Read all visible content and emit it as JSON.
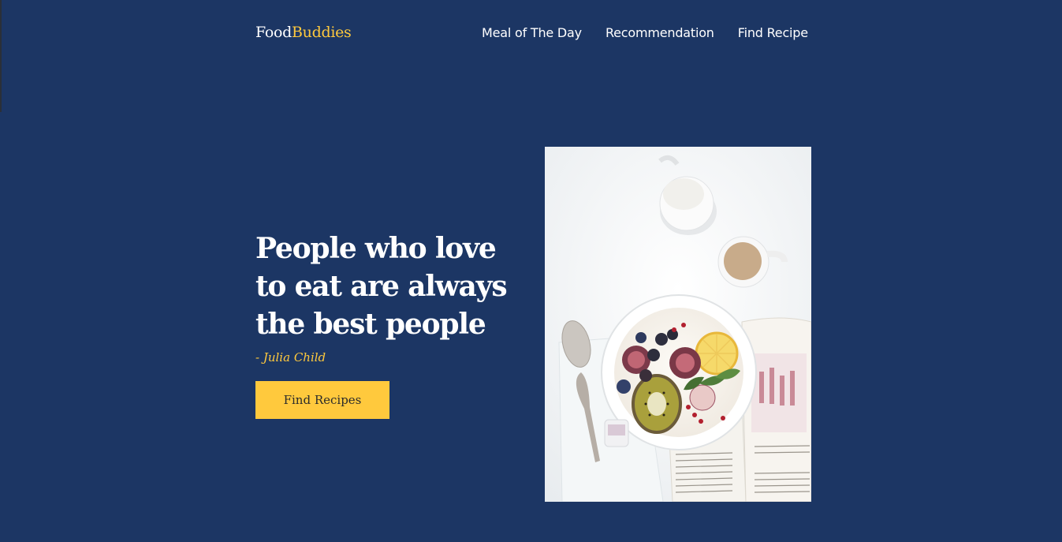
{
  "header": {
    "logo": {
      "part1": "Food",
      "part2": "Buddies"
    },
    "nav": [
      {
        "label": "Meal of The Day"
      },
      {
        "label": "Recommendation"
      },
      {
        "label": "Find Recipe"
      }
    ]
  },
  "hero": {
    "quote_line1": "People who love",
    "quote_line2": "to eat are always",
    "quote_line3": "the best people",
    "author": "- Julia Child",
    "cta_label": "Find Recipes"
  },
  "colors": {
    "background": "#1c3664",
    "accent": "#ffc93d",
    "text": "#ffffff"
  },
  "image": {
    "subject": "food-bowl-photo"
  }
}
